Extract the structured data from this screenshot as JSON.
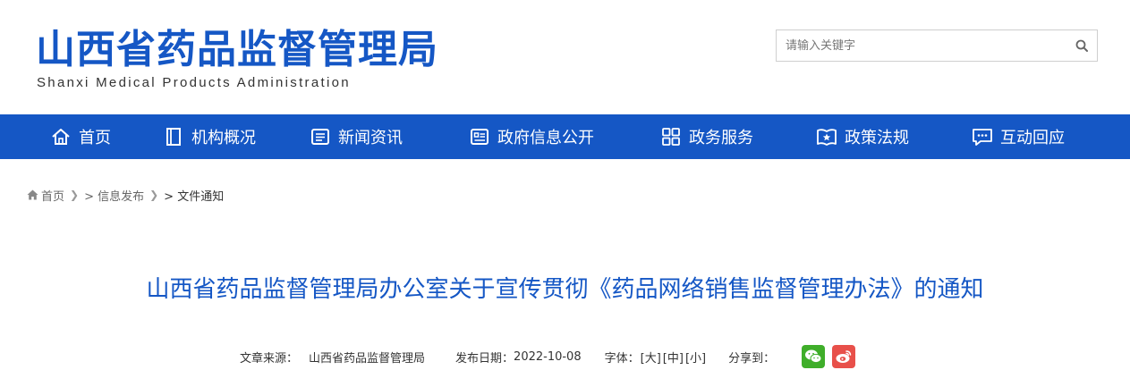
{
  "header": {
    "logo_cn": "山西省药品监督管理局",
    "logo_en": "Shanxi Medical Products Administration",
    "search_placeholder": "请输入关键字"
  },
  "nav": {
    "items": [
      {
        "label": "首页",
        "icon": "home-icon"
      },
      {
        "label": "机构概况",
        "icon": "book-icon"
      },
      {
        "label": "新闻资讯",
        "icon": "news-icon"
      },
      {
        "label": "政府信息公开",
        "icon": "info-card-icon"
      },
      {
        "label": "政务服务",
        "icon": "grid-icon"
      },
      {
        "label": "政策法规",
        "icon": "policy-book-icon"
      },
      {
        "label": "互动回应",
        "icon": "chat-icon"
      }
    ]
  },
  "breadcrumb": {
    "items": [
      "首页",
      "> 信息发布",
      "> 文件通知"
    ]
  },
  "article": {
    "title": "山西省药品监督管理局办公室关于宣传贯彻《药品网络销售监督管理办法》的通知",
    "source_label": "文章来源：",
    "source_value": "山西省药品监督管理局",
    "date_label": "发布日期：",
    "date_value": "2022-10-08",
    "font_label": "字体：",
    "font_large": "[大]",
    "font_medium": "[中]",
    "font_small": "[小]",
    "share_label": "分享到："
  },
  "colors": {
    "brand_blue": "#1557c5",
    "wechat_green": "#3fae2a",
    "weibo_red": "#e8504a"
  }
}
